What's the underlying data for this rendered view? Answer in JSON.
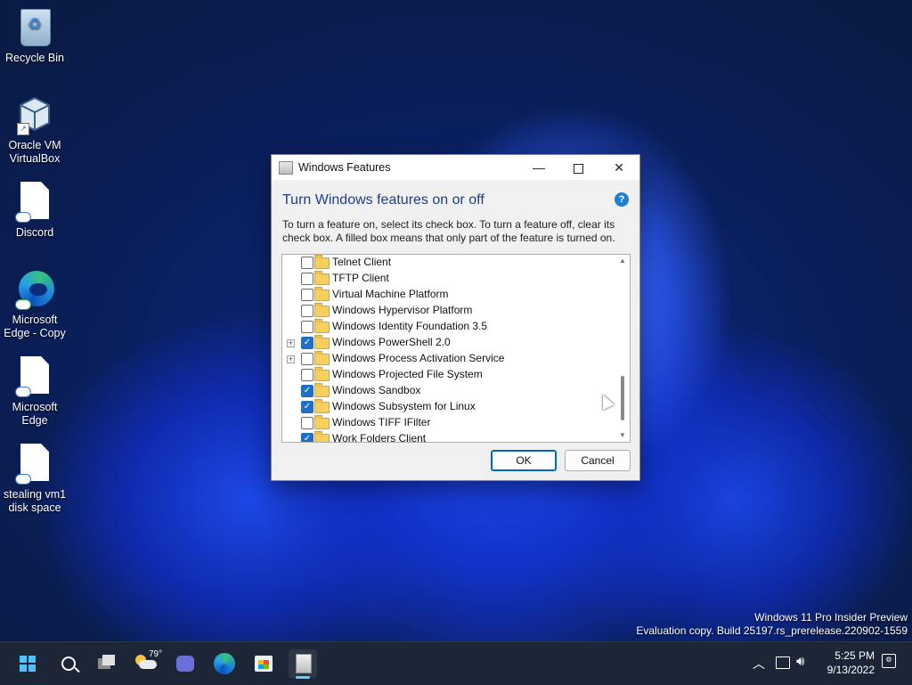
{
  "desktop": {
    "icons": [
      {
        "label": "Recycle Bin"
      },
      {
        "label": "Oracle VM VirtualBox"
      },
      {
        "label": "Discord"
      },
      {
        "label": "Microsoft Edge - Copy"
      },
      {
        "label": "Microsoft Edge"
      },
      {
        "label": "stealing vm1 disk space"
      }
    ]
  },
  "dialog": {
    "title": "Windows Features",
    "heading": "Turn Windows features on or off",
    "help_label": "?",
    "description": "To turn a feature on, select its check box. To turn a feature off, clear its check box. A filled box means that only part of the feature is turned on.",
    "features": [
      {
        "name": "Telnet Client",
        "checked": false,
        "expandable": false
      },
      {
        "name": "TFTP Client",
        "checked": false,
        "expandable": false
      },
      {
        "name": "Virtual Machine Platform",
        "checked": false,
        "expandable": false
      },
      {
        "name": "Windows Hypervisor Platform",
        "checked": false,
        "expandable": false
      },
      {
        "name": "Windows Identity Foundation 3.5",
        "checked": false,
        "expandable": false
      },
      {
        "name": "Windows PowerShell 2.0",
        "checked": true,
        "expandable": true
      },
      {
        "name": "Windows Process Activation Service",
        "checked": false,
        "expandable": true
      },
      {
        "name": "Windows Projected File System",
        "checked": false,
        "expandable": false
      },
      {
        "name": "Windows Sandbox",
        "checked": true,
        "expandable": false
      },
      {
        "name": "Windows Subsystem for Linux",
        "checked": true,
        "expandable": false
      },
      {
        "name": "Windows TIFF IFilter",
        "checked": false,
        "expandable": false
      },
      {
        "name": "Work Folders Client",
        "checked": true,
        "expandable": false
      }
    ],
    "ok_label": "OK",
    "cancel_label": "Cancel"
  },
  "watermark": {
    "line1": "Windows 11 Pro Insider Preview",
    "line2": "Evaluation copy. Build 25197.rs_prerelease.220902-1559"
  },
  "taskbar": {
    "weather_temp": "79°",
    "time": "5:25 PM",
    "date": "9/13/2022",
    "icons": [
      "start-icon",
      "search-icon",
      "task-view-icon",
      "weather-icon",
      "teams-chat-icon",
      "edge-icon",
      "store-icon",
      "windows-features-icon"
    ]
  },
  "colors": {
    "accent": "#0067c0",
    "taskbar_bg": "#1c2637",
    "heading": "#1e3e8c"
  }
}
